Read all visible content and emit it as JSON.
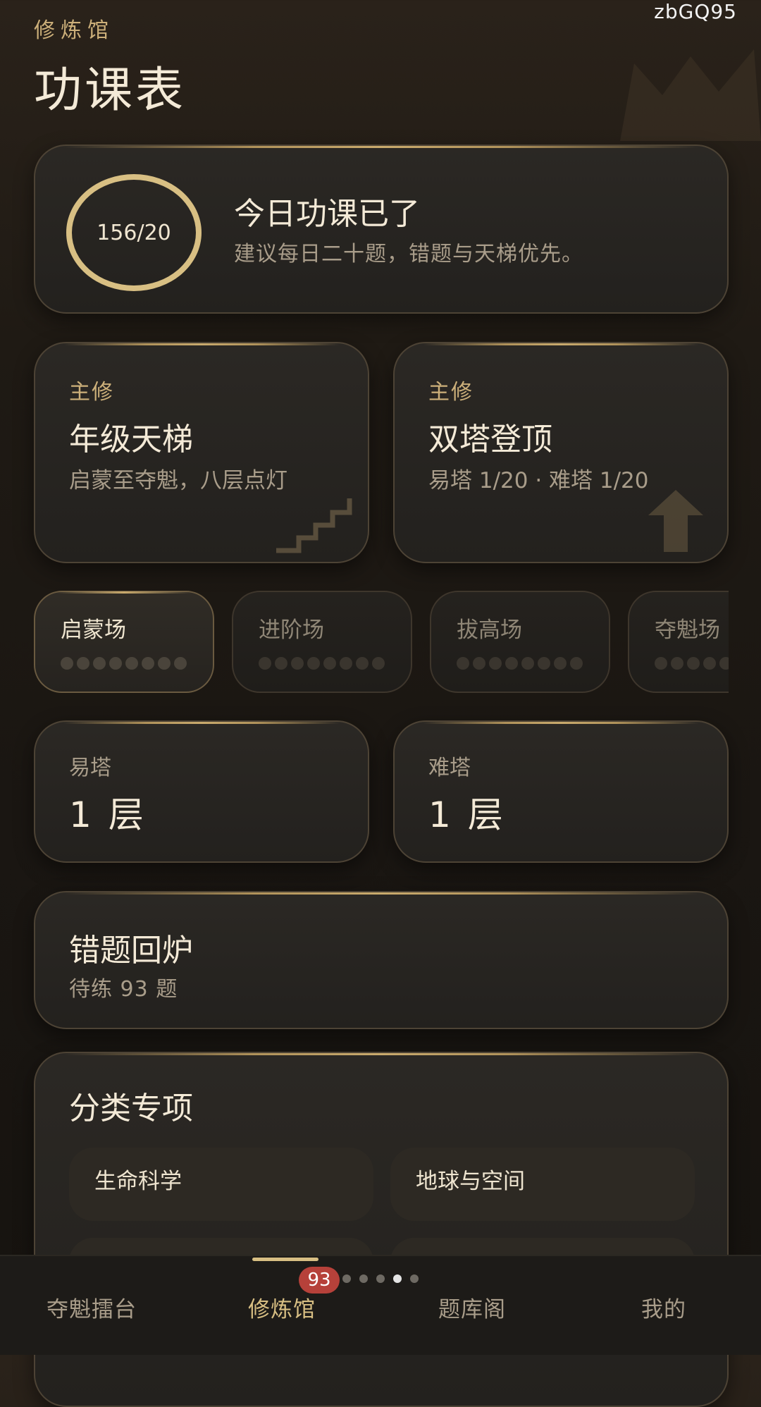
{
  "watermark": "zbGQ95",
  "header": {
    "section_tag": "修炼馆",
    "title": "功课表"
  },
  "progress": {
    "ring_text": "156/20",
    "title": "今日功课已了",
    "subtitle": "建议每日二十题，错题与天梯优先。"
  },
  "modes": [
    {
      "tag": "主修",
      "title": "年级天梯",
      "desc": "启蒙至夺魁，八层点灯"
    },
    {
      "tag": "主修",
      "title": "双塔登顶",
      "desc": "易塔 1/20 · 难塔 1/20"
    }
  ],
  "arenas": [
    {
      "label": "启蒙场",
      "active": true
    },
    {
      "label": "进阶场",
      "active": false
    },
    {
      "label": "拔高场",
      "active": false
    },
    {
      "label": "夺魁场",
      "active": false
    }
  ],
  "towers": [
    {
      "label": "易塔",
      "value": "1 层"
    },
    {
      "label": "难塔",
      "value": "1 层"
    }
  ],
  "review": {
    "title": "错题回炉",
    "subtitle": "待练 93 题"
  },
  "category": {
    "title": "分类专项",
    "items": [
      "生命科学",
      "地球与空间",
      "",
      ""
    ]
  },
  "bottom_nav": {
    "items": [
      "夺魁擂台",
      "修炼馆",
      "题库阁",
      "我的"
    ],
    "active_index": 1,
    "badge": "93"
  },
  "colors": {
    "accent_gold": "#d8bf83",
    "badge_red": "#b6413a",
    "background": "#1f1a14"
  }
}
